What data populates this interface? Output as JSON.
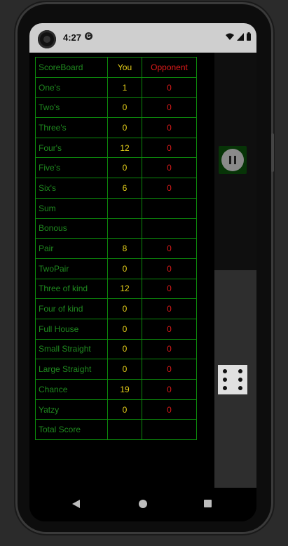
{
  "status_bar": {
    "time": "4:27",
    "notification_icon": "app-notification-icon",
    "icons": [
      "wifi-icon",
      "cellular-signal-icon",
      "battery-icon"
    ]
  },
  "scoreboard": {
    "header": {
      "label": "ScoreBoard",
      "you": "You",
      "opponent": "Opponent"
    },
    "rows": [
      {
        "label": "One's",
        "you": "1",
        "opponent": "0"
      },
      {
        "label": "Two's",
        "you": "0",
        "opponent": "0"
      },
      {
        "label": "Three's",
        "you": "0",
        "opponent": "0"
      },
      {
        "label": "Four's",
        "you": "12",
        "opponent": "0"
      },
      {
        "label": "Five's",
        "you": "0",
        "opponent": "0"
      },
      {
        "label": "Six's",
        "you": "6",
        "opponent": "0"
      },
      {
        "label": "Sum",
        "you": "",
        "opponent": ""
      },
      {
        "label": "Bonous",
        "you": "",
        "opponent": ""
      },
      {
        "label": "Pair",
        "you": "8",
        "opponent": "0"
      },
      {
        "label": "TwoPair",
        "you": "0",
        "opponent": "0"
      },
      {
        "label": "Three of kind",
        "you": "12",
        "opponent": "0"
      },
      {
        "label": "Four of kind",
        "you": "0",
        "opponent": "0"
      },
      {
        "label": "Full House",
        "you": "0",
        "opponent": "0"
      },
      {
        "label": "Small Straight",
        "you": "0",
        "opponent": "0"
      },
      {
        "label": "Large Straight",
        "you": "0",
        "opponent": "0"
      },
      {
        "label": "Chance",
        "you": "19",
        "opponent": "0"
      },
      {
        "label": "Yatzy",
        "you": "0",
        "opponent": "0"
      },
      {
        "label": "Total Score",
        "you": "",
        "opponent": ""
      }
    ]
  },
  "controls": {
    "pause_icon": "pause-icon",
    "die_face": 6
  },
  "nav_bar": {
    "icons": [
      "back-icon",
      "home-icon",
      "recents-icon"
    ]
  },
  "colors": {
    "grid": "#0c8a0c",
    "label_text": "#1f8a1f",
    "you_text": "#e8d11a",
    "opponent_text": "#e01b1b",
    "pause_bg": "#073407"
  }
}
